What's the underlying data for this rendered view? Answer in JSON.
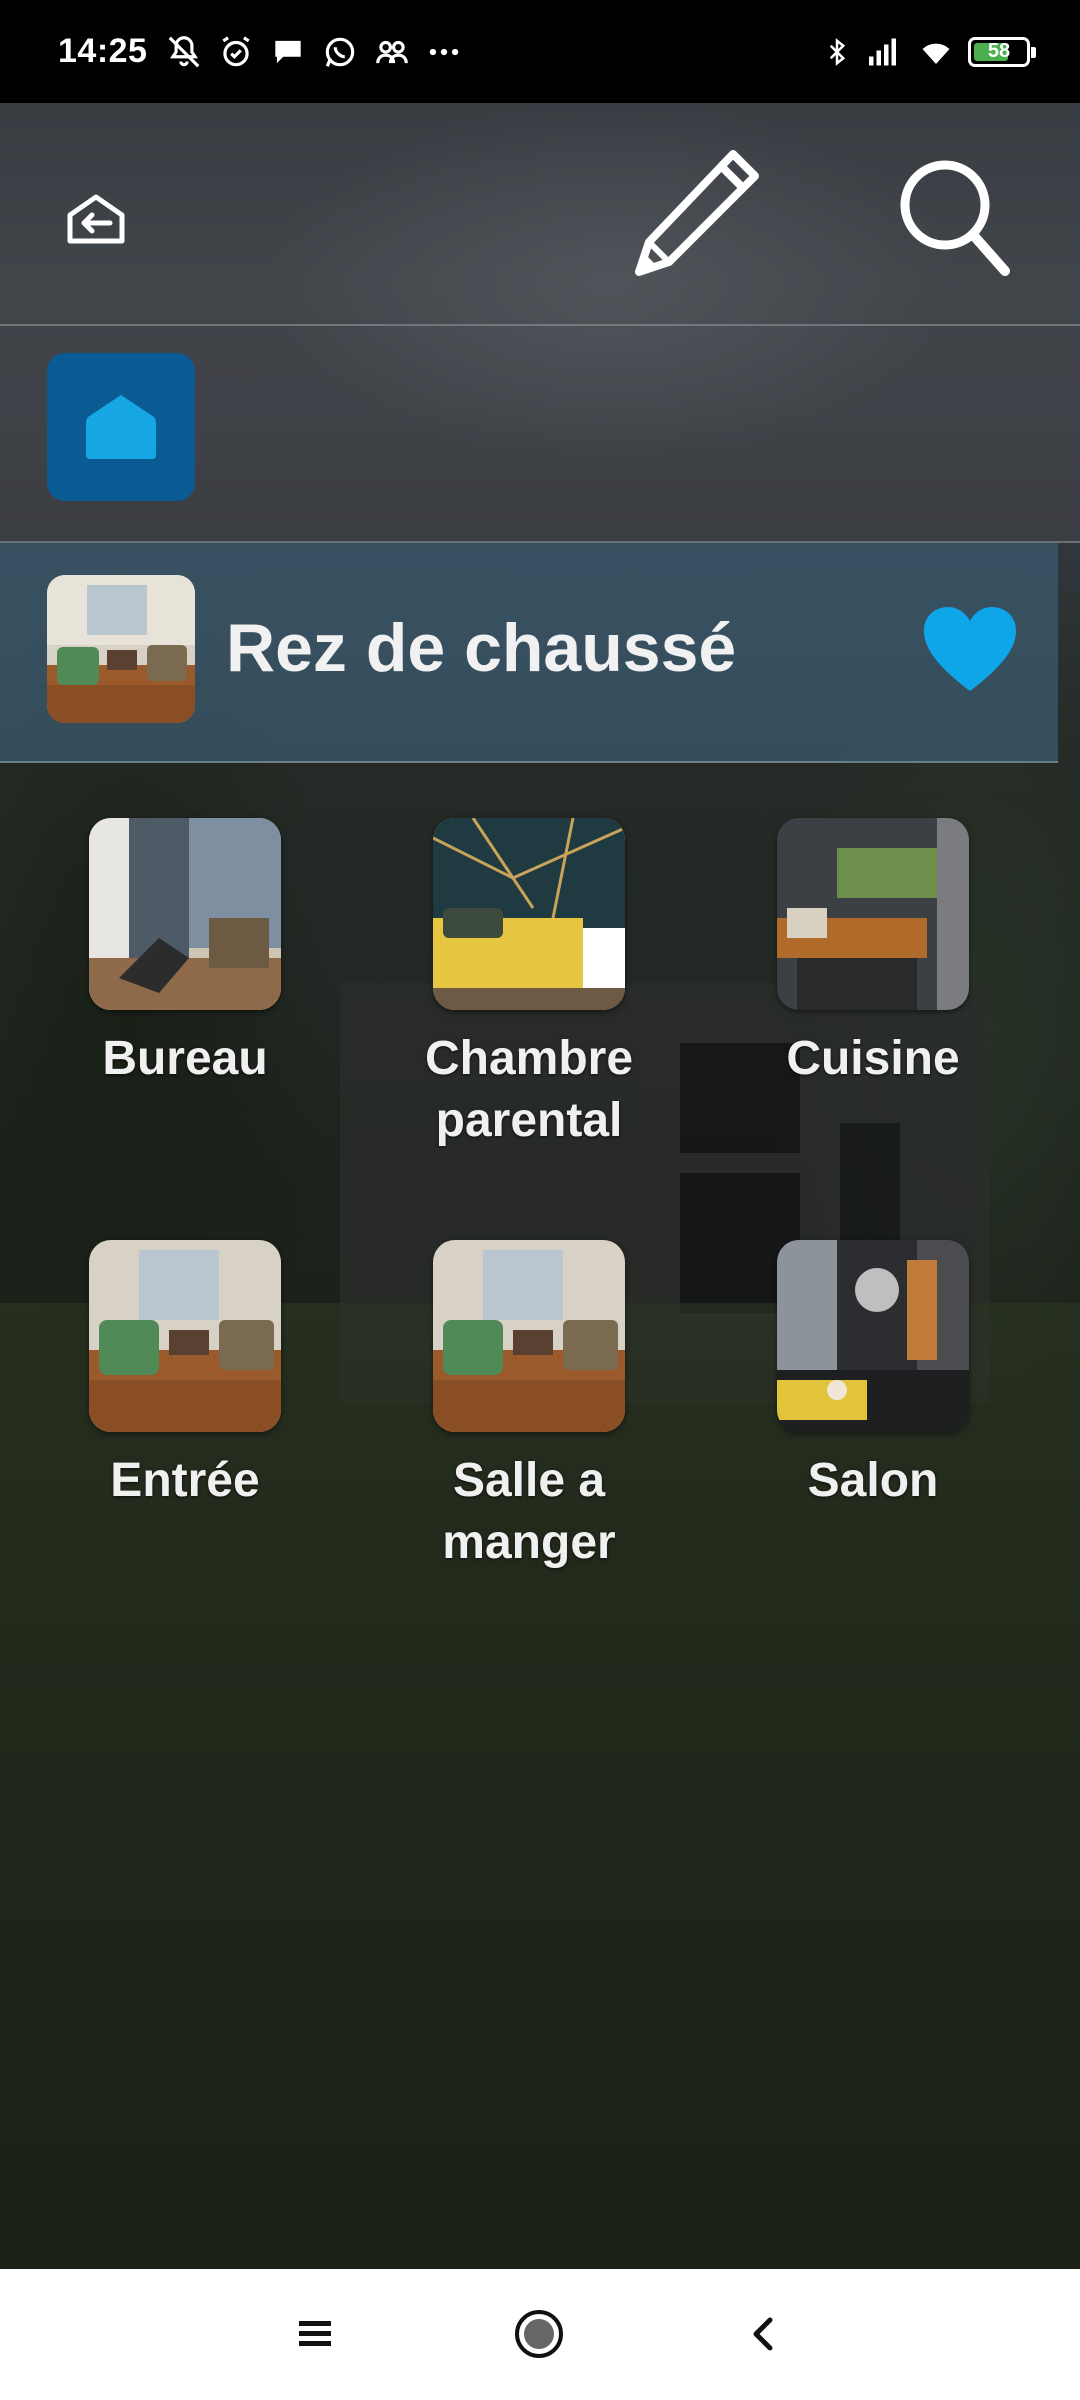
{
  "status_bar": {
    "time": "14:25",
    "icons": [
      "notifications-off-icon",
      "alarm-icon",
      "chat-bubble-icon",
      "whatsapp-icon",
      "group-icon",
      "more-dots-icon"
    ],
    "right_icons": [
      "bluetooth-icon",
      "signal-icon",
      "wifi-icon"
    ],
    "battery": 58
  },
  "header": {
    "actions": [
      "back-icon",
      "pencil-icon",
      "search-icon"
    ]
  },
  "home": {
    "icon": "house-icon",
    "color": "#0a5a94"
  },
  "floor": {
    "title": "Rez de chaussé",
    "favorite_icon": "heart-icon",
    "favorite_color": "#0ea5e9"
  },
  "rooms": [
    {
      "label": "Bureau"
    },
    {
      "label": "Chambre parental"
    },
    {
      "label": "Cuisine"
    },
    {
      "label": "Entrée"
    },
    {
      "label": "Salle a manger"
    },
    {
      "label": "Salon"
    }
  ],
  "navbar": {
    "items": [
      "menu-icon",
      "home-circle-icon",
      "back-chevron-icon"
    ]
  }
}
